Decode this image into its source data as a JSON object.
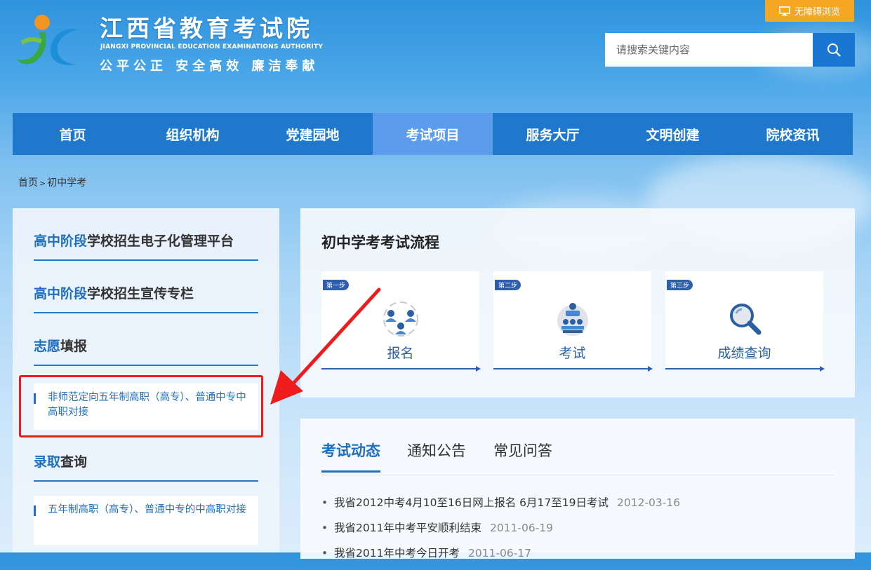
{
  "header": {
    "title": "江西省教育考试院",
    "subtitle": "JIANGXI PROVINCIAL EDUCATION EXAMINATIONS AUTHORITY",
    "slogan": "公平公正 安全高效 廉洁奉献",
    "accessibility_label": "无障碍浏览",
    "search": {
      "placeholder": "请搜索关键内容",
      "value": ""
    }
  },
  "nav": {
    "items": [
      "首页",
      "组织机构",
      "党建园地",
      "考试项目",
      "服务大厅",
      "文明创建",
      "院校资讯"
    ],
    "active": "考试项目"
  },
  "breadcrumb": {
    "home": "首页",
    "separator": ">",
    "current": "初中学考"
  },
  "sidebar": {
    "sections": [
      {
        "highlight": "高中阶段",
        "rest": "学校招生电子化管理平台"
      },
      {
        "highlight": "高中阶段",
        "rest": "学校招生宣传专栏"
      },
      {
        "highlight": "志愿",
        "rest": "填报"
      },
      {
        "highlight": "录取",
        "rest": "查询"
      }
    ],
    "subitems": [
      "非师范定向五年制高职（高专）、普通中专中高职对接",
      "五年制高职（高专）、普通中专的中高职对接"
    ]
  },
  "process": {
    "title": "初中学考考试流程",
    "steps": [
      {
        "badge": "第一步",
        "label": "报名",
        "icon": "users-registration-icon"
      },
      {
        "badge": "第二步",
        "label": "考试",
        "icon": "exam-hall-icon"
      },
      {
        "badge": "第三步",
        "label": "成绩查询",
        "icon": "magnifier-icon"
      }
    ]
  },
  "news": {
    "tabs": [
      "考试动态",
      "通知公告",
      "常见问答"
    ],
    "active_tab": "考试动态",
    "items": [
      {
        "title": "我省2012中考4月10至16日网上报名 6月17至19日考试",
        "date": "2012-03-16"
      },
      {
        "title": "我省2011年中考平安顺利结束",
        "date": "2011-06-19"
      },
      {
        "title": "我省2011年中考今日开考",
        "date": "2011-06-17"
      }
    ]
  },
  "colors": {
    "nav_bg": "#1f78cc",
    "nav_active": "#5b9cec",
    "accent_blue": "#1e6fc0",
    "accessibility_orange": "#f5a623",
    "annotation_red": "#ee1c1c"
  }
}
